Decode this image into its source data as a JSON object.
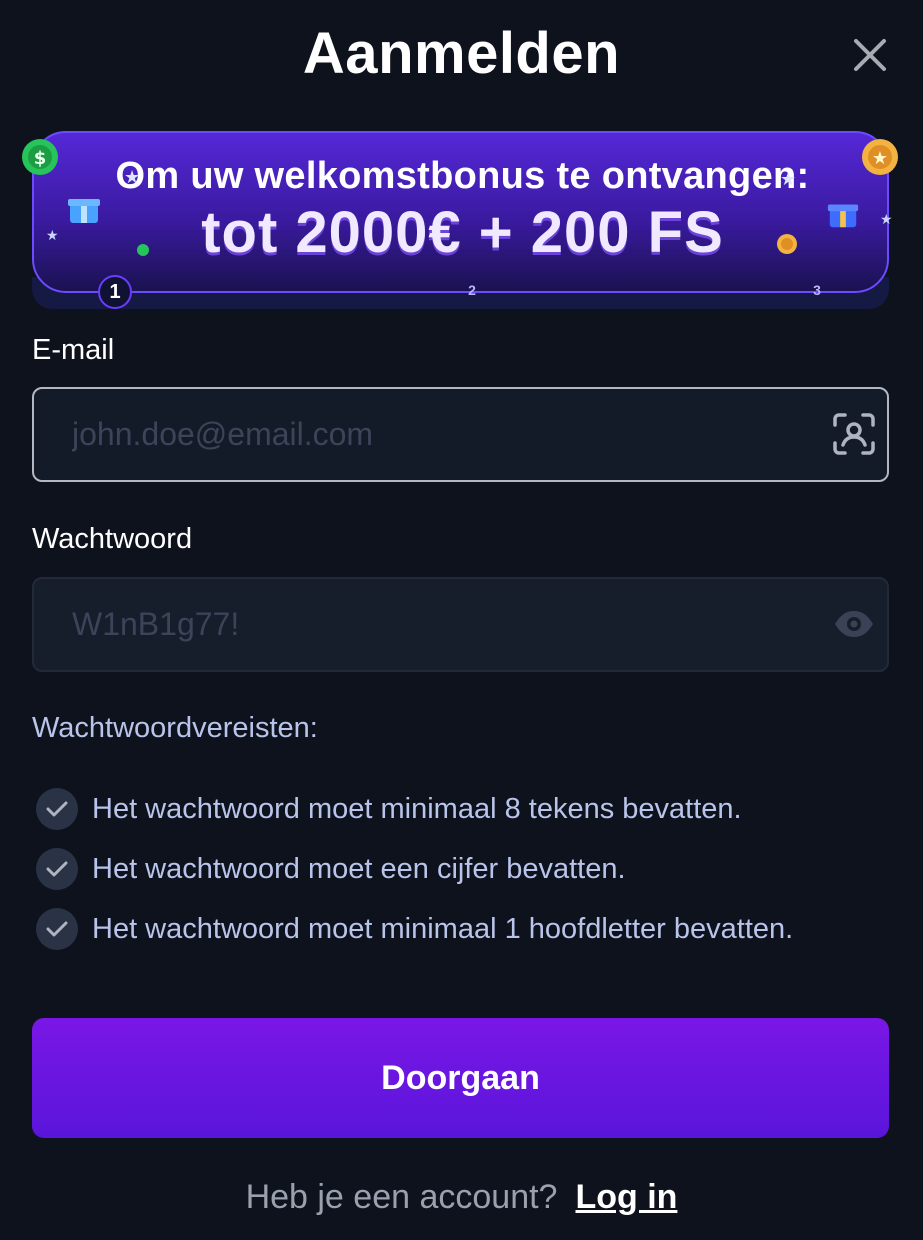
{
  "header": {
    "title": "Aanmelden",
    "close_icon": "close-icon"
  },
  "banner": {
    "line1": "Om uw welkomstbonus te ontvangen:",
    "line2": "tot 2000€ + 200 FS",
    "steps": [
      "1",
      "2",
      "3"
    ],
    "active_step": 1
  },
  "form": {
    "email": {
      "label": "E-mail",
      "placeholder": "john.doe@email.com",
      "value": "",
      "icon": "user-scan-icon"
    },
    "password": {
      "label": "Wachtwoord",
      "placeholder": "W1nB1g77!",
      "value": "",
      "icon": "eye-icon"
    },
    "requirements_title": "Wachtwoordvereisten:",
    "requirements": [
      "Het wachtwoord moet minimaal 8 tekens bevatten.",
      "Het wachtwoord moet een cijfer bevatten.",
      "Het wachtwoord moet minimaal 1 hoofdletter bevatten."
    ],
    "submit_label": "Doorgaan"
  },
  "footer": {
    "prompt": "Heb je een account?",
    "login_label": "Log in"
  },
  "colors": {
    "background": "#0e121d",
    "accent": "#6a16e0",
    "muted_text": "#b9c4ea"
  }
}
